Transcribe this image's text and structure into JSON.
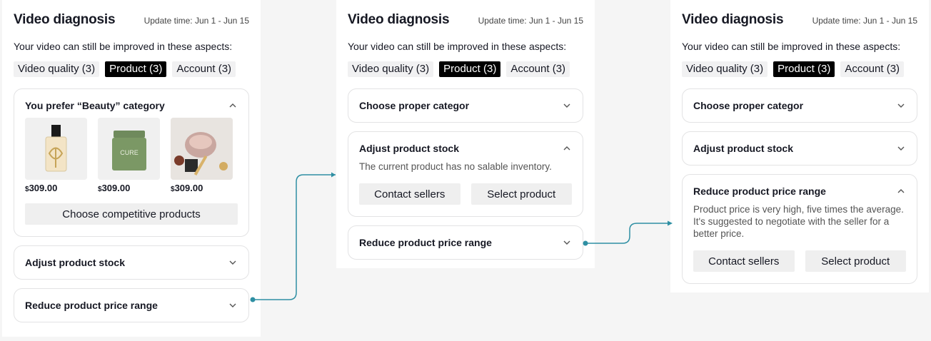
{
  "panels": [
    {
      "title": "Video diagnosis",
      "update_time": "Update time: Jun 1 - Jun 15",
      "subtitle": "Your video can still be improved in these aspects:",
      "tabs": [
        {
          "label": "Video quality (3)",
          "active": false
        },
        {
          "label": "Product (3)",
          "active": true
        },
        {
          "label": "Account (3)",
          "active": false
        }
      ],
      "cards": [
        {
          "title": "You prefer “Beauty” category",
          "expanded": true,
          "products": [
            {
              "currency": "$",
              "price": "309.00",
              "image": "perfume-bottle"
            },
            {
              "currency": "$",
              "price": "309.00",
              "image": "cream-jar",
              "label": "CURE"
            },
            {
              "currency": "$",
              "price": "309.00",
              "image": "skincare-set"
            }
          ],
          "action": "Choose competitive products"
        },
        {
          "title": "Adjust product stock",
          "expanded": false
        },
        {
          "title": "Reduce product price range",
          "expanded": false
        }
      ]
    },
    {
      "title": "Video diagnosis",
      "update_time": "Update time: Jun 1 - Jun 15",
      "subtitle": "Your video can still be improved in these aspects:",
      "tabs": [
        {
          "label": "Video quality (3)",
          "active": false
        },
        {
          "label": "Product (3)",
          "active": true
        },
        {
          "label": "Account (3)",
          "active": false
        }
      ],
      "cards": [
        {
          "title": "Choose proper categor",
          "expanded": false
        },
        {
          "title": "Adjust product stock",
          "expanded": true,
          "description": "The current product has no salable inventory.",
          "buttons": [
            "Contact sellers",
            "Select product"
          ]
        },
        {
          "title": "Reduce product price range",
          "expanded": false
        }
      ]
    },
    {
      "title": "Video diagnosis",
      "update_time": "Update time: Jun 1 - Jun 15",
      "subtitle": "Your video can still be improved in these aspects:",
      "tabs": [
        {
          "label": "Video quality (3)",
          "active": false
        },
        {
          "label": "Product (3)",
          "active": true
        },
        {
          "label": "Account (3)",
          "active": false
        }
      ],
      "cards": [
        {
          "title": "Choose proper categor",
          "expanded": false
        },
        {
          "title": "Adjust product stock",
          "expanded": false
        },
        {
          "title": "Reduce product price range",
          "expanded": true,
          "description": "Product price is very high, five times the average. It's suggested to negotiate with the seller for a better price.",
          "buttons": [
            "Contact sellers",
            "Select product"
          ]
        }
      ]
    }
  ],
  "colors": {
    "connector": "#2e8fa3",
    "active_tab": "#000000",
    "button_bg": "#efefef",
    "page_bg": "#f5f5f5"
  },
  "icons": {
    "expanded": "chevron-up-icon",
    "collapsed": "chevron-down-icon"
  }
}
